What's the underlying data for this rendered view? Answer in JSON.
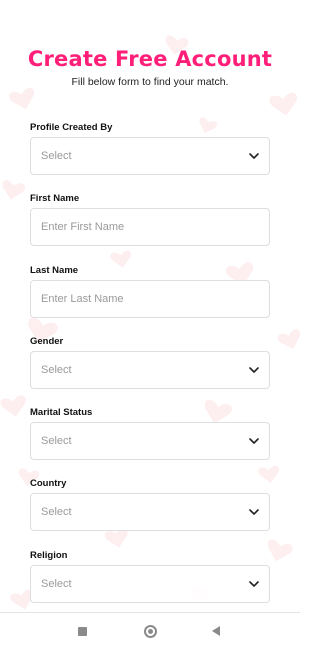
{
  "header": {
    "title": "Create Free Account",
    "subtitle": "Fill below form to find your match."
  },
  "form": {
    "profile_created_by": {
      "label": "Profile Created By",
      "value": "Select"
    },
    "first_name": {
      "label": "First Name",
      "placeholder": "Enter First Name"
    },
    "last_name": {
      "label": "Last Name",
      "placeholder": "Enter Last Name"
    },
    "gender": {
      "label": "Gender",
      "value": "Select"
    },
    "marital_status": {
      "label": "Marital Status",
      "value": "Select"
    },
    "country": {
      "label": "Country",
      "value": "Select"
    },
    "religion": {
      "label": "Religion",
      "value": "Select"
    }
  },
  "icons": {
    "select": "chevron-down-icon",
    "nav": [
      "recent-apps-icon",
      "home-icon",
      "back-icon"
    ],
    "background": "heart-icon"
  },
  "colors": {
    "accent": "#ff1e78",
    "heart": "#fdeef0",
    "placeholder": "#9a9a9a",
    "border": "#dedede",
    "nav_icon": "#8a8a8a"
  }
}
